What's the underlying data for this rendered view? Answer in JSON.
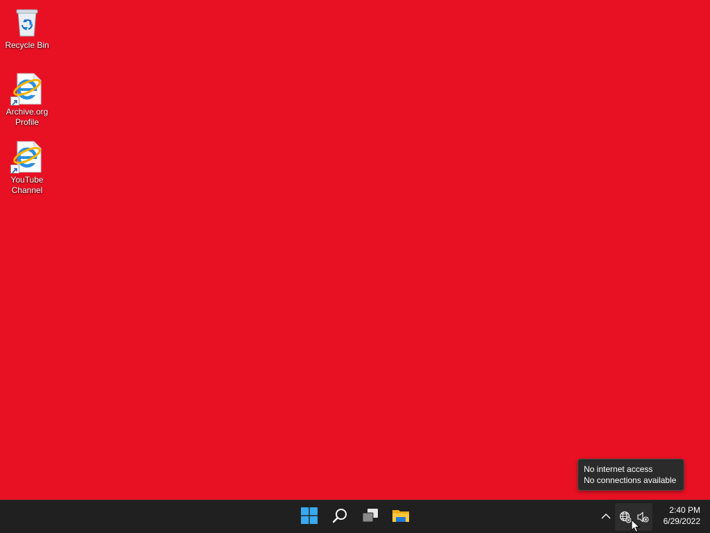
{
  "desktop": {
    "background_color": "#e81123",
    "icons": [
      {
        "label": "Recycle Bin",
        "icon": "recycle-bin-icon"
      },
      {
        "label": "Archive.org Profile",
        "icon": "internet-explorer-shortcut-icon"
      },
      {
        "label": "YouTube Channel",
        "icon": "internet-explorer-shortcut-icon"
      }
    ]
  },
  "tooltip": {
    "line1": "No internet access",
    "line2": "No connections available"
  },
  "taskbar": {
    "background_color": "#202020",
    "apps": [
      {
        "name": "Start",
        "icon": "windows-start-icon"
      },
      {
        "name": "Search",
        "icon": "search-icon"
      },
      {
        "name": "Task View",
        "icon": "task-view-icon"
      },
      {
        "name": "File Explorer",
        "icon": "folder-icon"
      }
    ],
    "tray": {
      "chevron": "chevron-up-icon",
      "network": "globe-no-internet-icon",
      "volume": "speaker-muted-icon"
    },
    "clock": {
      "time": "2:40 PM",
      "date": "6/29/2022"
    }
  }
}
